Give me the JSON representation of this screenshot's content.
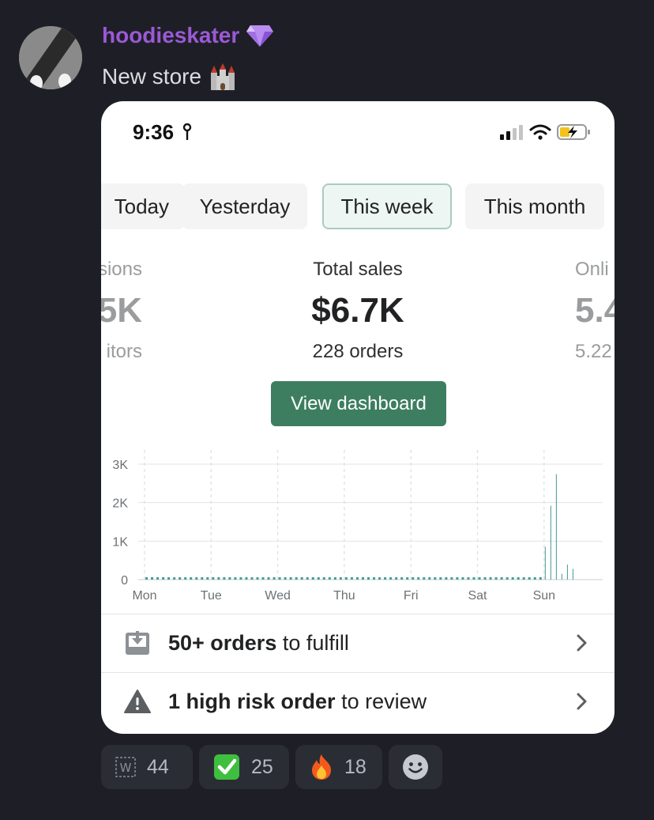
{
  "post": {
    "username": "hoodieskater",
    "message": "New store"
  },
  "screenshot": {
    "status": {
      "time": "9:36"
    },
    "tabs": [
      "Today",
      "Yesterday",
      "This week",
      "This month"
    ],
    "active_tab": "This week",
    "metrics": {
      "left": {
        "label": "sions",
        "value": "5K",
        "sub": "itors"
      },
      "center": {
        "label": "Total sales",
        "value": "$6.7K",
        "sub": "228 orders"
      },
      "right": {
        "label": "Onli",
        "value": "5.4",
        "sub": "5.22"
      }
    },
    "view_dashboard_label": "View dashboard",
    "tasks": [
      {
        "bold": "50+ orders",
        "rest": " to fulfill"
      },
      {
        "bold": "1 high risk order",
        "rest": " to review"
      }
    ],
    "colors": {
      "accent": "#3d7e60",
      "bar": "#479b97"
    }
  },
  "chart_data": {
    "type": "bar",
    "categories": [
      "Mon",
      "Tue",
      "Wed",
      "Thu",
      "Fri",
      "Sat",
      "Sun"
    ],
    "y_ticks": [
      "0",
      "1K",
      "2K",
      "3K"
    ],
    "ylim": [
      0,
      3000
    ],
    "grid": true,
    "series_values": [
      0,
      0,
      0,
      0,
      0,
      0,
      0,
      0,
      0,
      0,
      0,
      0,
      0,
      0,
      0,
      0,
      0,
      0,
      0,
      0,
      0,
      0,
      0,
      0,
      0,
      0,
      0,
      0,
      0,
      0,
      0,
      0,
      0,
      0,
      0,
      0,
      0,
      0,
      0,
      0,
      0,
      0,
      0,
      0,
      0,
      0,
      0,
      0,
      0,
      0,
      0,
      0,
      0,
      0,
      0,
      0,
      0,
      0,
      0,
      0,
      0,
      0,
      0,
      0,
      0,
      0,
      0,
      0,
      0,
      0,
      0,
      0,
      850,
      1920,
      2740,
      150,
      390,
      280
    ],
    "bucket_hours": 2
  },
  "reactions": [
    {
      "icon": "w-emoji",
      "count": "44"
    },
    {
      "icon": "check-mark-emoji",
      "count": "25"
    },
    {
      "icon": "fire-emoji",
      "count": "18"
    }
  ]
}
